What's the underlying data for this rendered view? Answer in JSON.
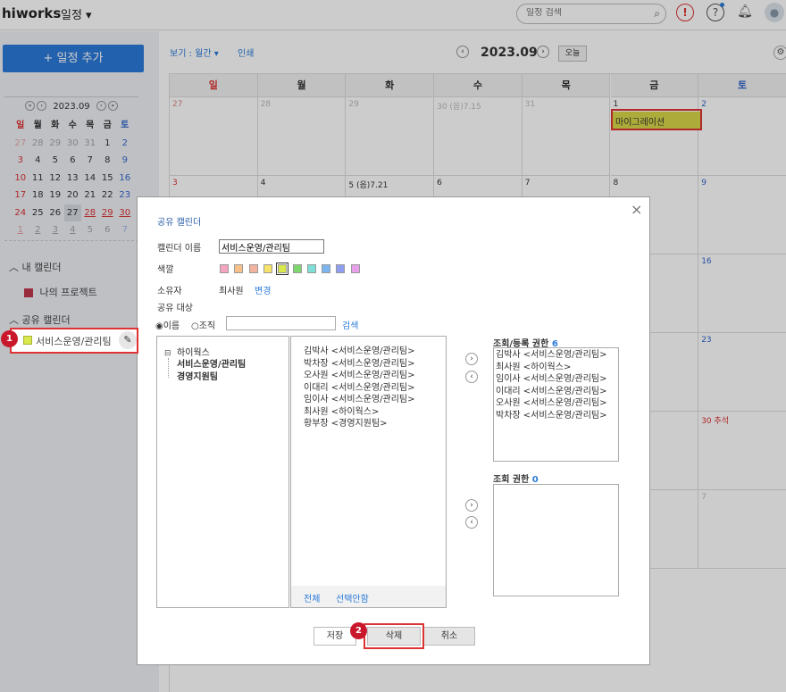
{
  "header": {
    "logo": "hiworks",
    "app": "일정 ▾",
    "search_placeholder": "일정 검색"
  },
  "sidebar": {
    "add_button": "+ 일정 추가",
    "mini_calendar": {
      "month": "2023.09",
      "weekdays": [
        "일",
        "월",
        "화",
        "수",
        "목",
        "금",
        "토"
      ],
      "weeks": [
        [
          "27",
          "28",
          "29",
          "30",
          "31",
          "1",
          "2"
        ],
        [
          "3",
          "4",
          "5",
          "6",
          "7",
          "8",
          "9"
        ],
        [
          "10",
          "11",
          "12",
          "13",
          "14",
          "15",
          "16"
        ],
        [
          "17",
          "18",
          "19",
          "20",
          "21",
          "22",
          "23"
        ],
        [
          "24",
          "25",
          "26",
          "27",
          "28",
          "29",
          "30"
        ],
        [
          "1",
          "2",
          "3",
          "4",
          "5",
          "6",
          "7"
        ]
      ]
    },
    "my_calendars_title": "내 캘린더",
    "my_calendars": [
      {
        "name": "나의 프로젝트",
        "color": "#c0384c"
      }
    ],
    "shared_calendars_title": "공유 캘린더",
    "shared_calendars": [
      {
        "name": "서비스운영/관리팀",
        "color": "#d9e84a"
      }
    ]
  },
  "toolbar": {
    "view": "보기 : 월간 ▾",
    "print": "인쇄",
    "month": "2023.09",
    "today": "오늘"
  },
  "calendar": {
    "weekdays": [
      "일",
      "월",
      "화",
      "수",
      "목",
      "금",
      "토"
    ],
    "week1": [
      "27",
      "28",
      "29",
      "30 (음)7.15",
      "31",
      "1",
      "2"
    ],
    "week2": [
      "3",
      "4",
      "5 (음)7.21",
      "6",
      "7",
      "8",
      "9"
    ],
    "right_dates": [
      "16",
      "23",
      "30 추석",
      "7"
    ],
    "event": "마이그레이션"
  },
  "dialog": {
    "title": "공유 캘린더",
    "name_label": "캘린더 이름",
    "name_value": "서비스운영/관리팀",
    "color_label": "색깔",
    "colors": [
      "#f4a6c0",
      "#f7c08a",
      "#f4b3a0",
      "#f7e36a",
      "#d9e84a",
      "#7ed66f",
      "#7ee0d8",
      "#7bb6f0",
      "#8f9ff0",
      "#e8a0ea"
    ],
    "owner_label": "소유자",
    "owner_value": "최사원",
    "owner_change": "변경",
    "share_target_label": "공유 대상",
    "radio_name": "이름",
    "radio_org": "조직",
    "search_button": "검색",
    "tree": {
      "root": "하이웍스",
      "children": [
        "서비스운영/관리팀",
        "경영지원팀"
      ]
    },
    "members": [
      "김박사 <서비스운영/관리팀>",
      "박차장 <서비스운영/관리팀>",
      "오사원 <서비스운영/관리팀>",
      "이대리 <서비스운영/관리팀>",
      "임이사 <서비스운영/관리팀>",
      "최사원 <하이웍스>",
      "황부장 <경영지원팀>"
    ],
    "select_all": "전체",
    "deselect": "선택안함",
    "rw_label": "조회/등록 권한",
    "rw_count": "6",
    "rw_members": [
      "김박사 <서비스운영/관리팀>",
      "최사원 <하이웍스>",
      "임이사 <서비스운영/관리팀>",
      "이대리 <서비스운영/관리팀>",
      "오사원 <서비스운영/관리팀>",
      "박차장 <서비스운영/관리팀>"
    ],
    "r_label": "조회 권한",
    "r_count": "0",
    "save": "저장",
    "delete": "삭제",
    "cancel": "취소"
  },
  "annotations": {
    "badge1": "1",
    "badge2": "2"
  }
}
